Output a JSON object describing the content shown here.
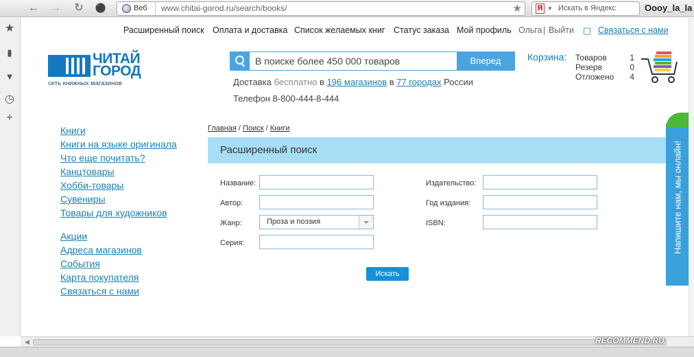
{
  "browser": {
    "search_mode": "Веб",
    "url": "www.chitai-gorod.ru/search/books/",
    "yandex_logo": "Я",
    "yandex_placeholder": "Искать в Яндекс",
    "username": "Oooy_la_la"
  },
  "header": {
    "nav": [
      "Расширенный поиск",
      "Оплата и доставка",
      "Список желаемых книг",
      "Статус заказа",
      "Мой профиль"
    ],
    "user": "Ольга",
    "logout": "Выйти",
    "contact": "Связаться с нами",
    "logo_line1": "ЧИТАЙ",
    "logo_line2": "ГОРОД",
    "logo_sub": "сеть книжных магазинов"
  },
  "search": {
    "placeholder": "В поиске более 450 000 товаров",
    "button": "Вперед"
  },
  "delivery": {
    "p1": "Доставка",
    "p2": "бесплатно",
    "p3": "в",
    "shops_link": "196 магазинов",
    "p4": "в",
    "cities_link": "77 городах",
    "p5": "России",
    "phone": "Телефон 8-800-444-8-444"
  },
  "cart": {
    "label": "Корзина:",
    "rows": [
      {
        "label": "Товаров",
        "count": "1"
      },
      {
        "label": "Резерв",
        "count": "0"
      },
      {
        "label": "Отложено",
        "count": "4"
      }
    ]
  },
  "left_menu": {
    "group1": [
      "Книги",
      "Книги на языке оригинала",
      "Что еще почитать?",
      "Канцтовары",
      "Хобби-товары",
      "Сувениры",
      "Товары для художников"
    ],
    "group2": [
      "Акции",
      "Адреса магазинов",
      "События",
      "Карта покупателя",
      "Связаться с нами"
    ]
  },
  "breadcrumbs": [
    "Главная",
    "Поиск",
    "Книги"
  ],
  "form": {
    "title": "Расширенный поиск",
    "title_label": "Название:",
    "author_label": "Автор:",
    "genre_label": "Жанр:",
    "genre_value": "Проза и поэзия",
    "series_label": "Серия:",
    "publisher_label": "Издательство:",
    "year_label": "Год издания:",
    "isbn_label": "ISBN:",
    "submit": "Искать"
  },
  "chat_tab": "Напишите нам, мы онлайн!",
  "watermark": "RECOMMEND.RU"
}
